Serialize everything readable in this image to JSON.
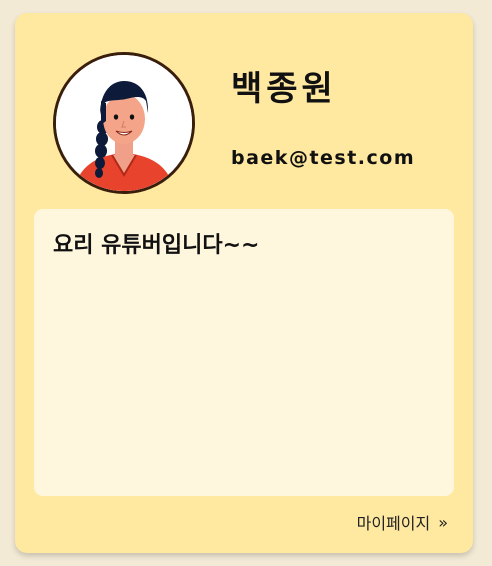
{
  "profile": {
    "name": "백종원",
    "email": "baek@test.com",
    "avatar_icon": "woman-braid-avatar",
    "bio": "요리 유튜버입니다~~"
  },
  "footer": {
    "mypage_label": "마이페이지",
    "chevron_icon": "double-chevron-right-icon",
    "chevron_glyph": "»"
  },
  "colors": {
    "page_bg": "#f3ead6",
    "card_bg": "#ffe8a0",
    "bio_bg": "#fff6de",
    "avatar_border": "#3a1e0c"
  }
}
